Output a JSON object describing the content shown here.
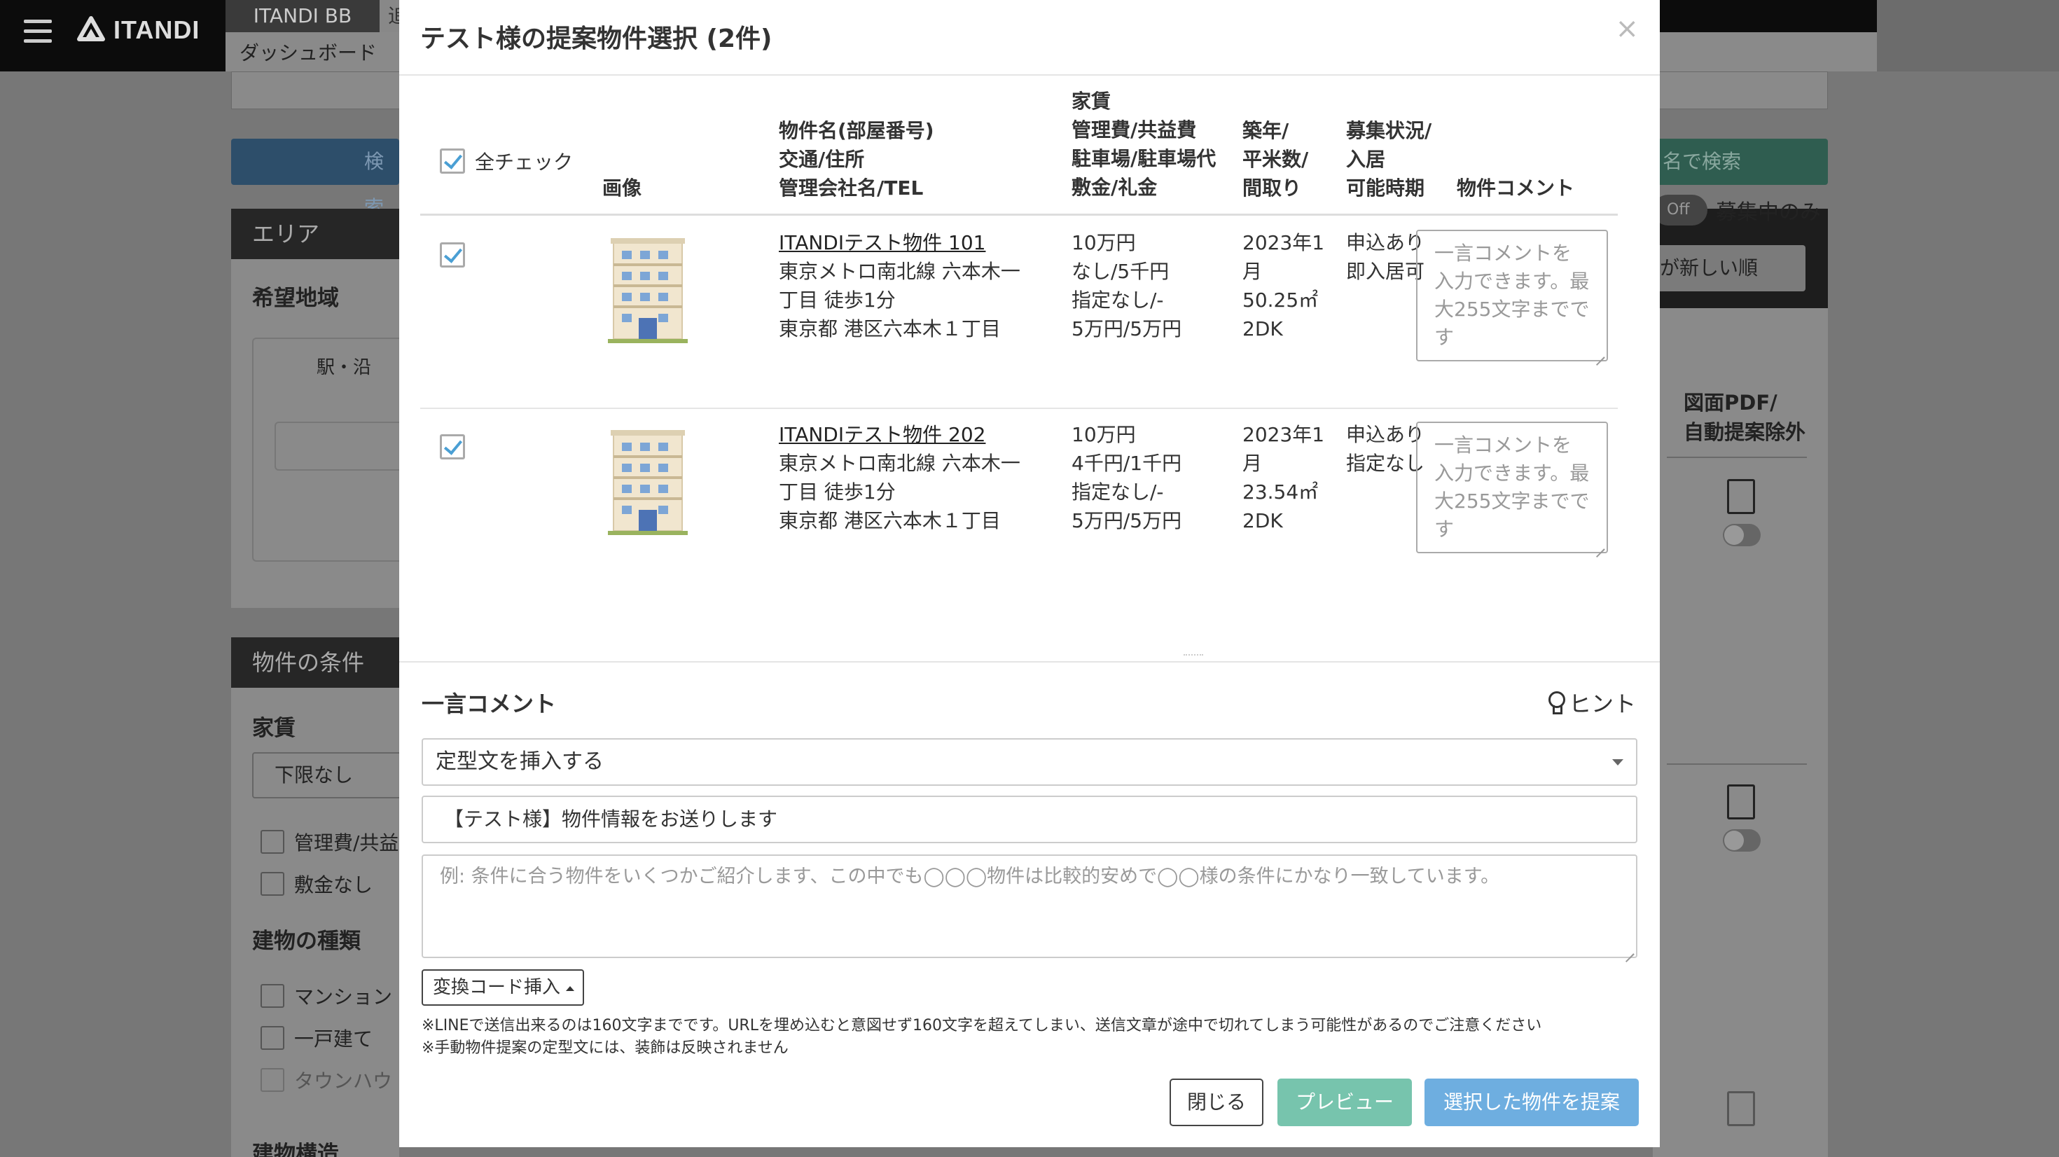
{
  "app": {
    "logo_text": "ITANDI",
    "active_tab": "ITANDI BB",
    "partial_tab": "追",
    "breadcrumb": "ダッシュボード"
  },
  "background": {
    "search_btn_left": "検索",
    "search_btn_right": "名で検索",
    "area_panel_title": "エリア",
    "area_sub": "希望地域",
    "station_label": "駅・沿",
    "conditions_title": "物件の条件",
    "rent_label": "家賃",
    "rent_select": "下限なし",
    "check_mgmt": "管理費/共益",
    "check_deposit": "敷金なし",
    "building_type_label": "建物の種類",
    "check_mansion": "マンション",
    "check_house": "一戸建て",
    "check_townhouse": "タウンハウ",
    "structure_label": "建物構造",
    "toggle_off": "Off",
    "recruit_only": "募集中のみ",
    "sort_value": "が新しい順",
    "pdf_header_1": "図面PDF/",
    "pdf_header_2": "自動提案除外"
  },
  "modal": {
    "title": "テスト様の提案物件選択 (2件)",
    "close": "×",
    "check_all_label": "全チェック",
    "headers": {
      "image": "画像",
      "name_lines": [
        "物件名(部屋番号)",
        "交通/住所",
        "管理会社名/TEL"
      ],
      "rent_lines": [
        "家賃",
        "管理費/共益費",
        "駐車場/駐車場代",
        "敷金/礼金"
      ],
      "age_lines": [
        "築年/",
        "平米数/",
        "間取り"
      ],
      "status_lines": [
        "募集状況/",
        "入居",
        "可能時期"
      ],
      "comment": "物件コメント"
    },
    "rows": [
      {
        "name": "ITANDIテスト物件 101",
        "access_1": "東京メトロ南北線 六本木一",
        "access_2": "丁目 徒歩1分",
        "address": "東京都 港区六本木１丁目",
        "rent": "10万円",
        "mgmt": "なし/5千円",
        "parking": "指定なし/-",
        "deposit": "5万円/5万円",
        "built_1": "2023年1",
        "built_2": "月",
        "area": "50.25㎡",
        "layout": "2DK",
        "status": "申込あり",
        "move_in": "即入居可",
        "comment_placeholder": "一言コメントを入力できます。最大255文字までです"
      },
      {
        "name": "ITANDIテスト物件 202",
        "access_1": "東京メトロ南北線 六本木一",
        "access_2": "丁目 徒歩1分",
        "address": "東京都 港区六本木１丁目",
        "rent": "10万円",
        "mgmt": "4千円/1千円",
        "parking": "指定なし/-",
        "deposit": "5万円/5万円",
        "built_1": "2023年1",
        "built_2": "月",
        "area": "23.54㎡",
        "layout": "2DK",
        "status": "申込あり",
        "move_in": "指定なし",
        "comment_placeholder": "一言コメントを入力できます。最大255文字までです"
      }
    ],
    "footer": {
      "title": "一言コメント",
      "hint": "ヒント",
      "template_select": "定型文を挿入する",
      "subject_value": "【テスト様】物件情報をお送りします",
      "message_placeholder": "例: 条件に合う物件をいくつかご紹介します、この中でも◯◯◯物件は比較的安めで◯◯様の条件にかなり一致しています。",
      "code_insert": "変換コード挿入",
      "note_1": "※LINEで送信出来るのは160文字までです。URLを埋め込むと意図せず160文字を超えてしまい、送信文章が途中で切れてしまう可能性があるのでご注意ください",
      "note_2": "※手動物件提案の定型文には、装飾は反映されません",
      "btn_close": "閉じる",
      "btn_preview": "プレビュー",
      "btn_propose": "選択した物件を提案"
    }
  },
  "colors": {
    "preview_green": "#77c4ad",
    "propose_blue": "#6eaee0",
    "checkbox_blue": "#4a9fd4"
  }
}
